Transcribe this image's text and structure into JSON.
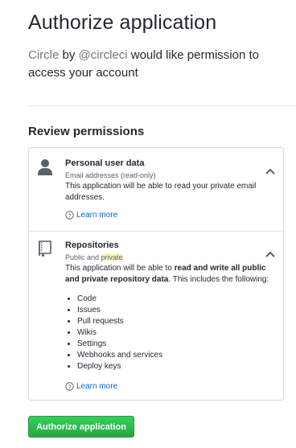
{
  "page": {
    "title": "Authorize application",
    "lead": {
      "app_name": "Circle",
      "by": " by ",
      "handle": "@circleci",
      "rest": " would like permission to access your account"
    },
    "section_title": "Review permissions",
    "authorize_label": "Authorize application"
  },
  "permissions": [
    {
      "name": "Personal user data",
      "scope": "Email addresses (read-only)",
      "description": "This application will be able to read your private email addresses.",
      "learn_more": "Learn more",
      "icon": "person-icon"
    },
    {
      "name": "Repositories",
      "scope_prefix": "Public and ",
      "scope_highlight": "private",
      "desc_start": "This application will be able to ",
      "desc_bold": "read and write all public and private repository data",
      "desc_end": ". This includes the following:",
      "items": [
        "Code",
        "Issues",
        "Pull requests",
        "Wikis",
        "Settings",
        "Webhooks and services",
        "Deploy keys"
      ],
      "learn_more": "Learn more",
      "icon": "repo-book-icon"
    }
  ],
  "colors": {
    "link": "#0366d6",
    "muted": "#767676",
    "button": "#28a745",
    "highlight": "#fff8c5"
  }
}
